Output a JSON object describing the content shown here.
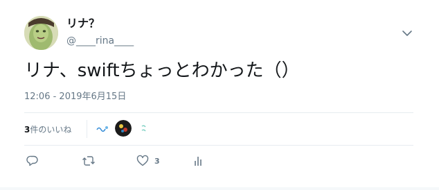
{
  "tweet": {
    "author": {
      "display_name": "リナ？",
      "handle": "@____rina____",
      "avatar_icon": "user-avatar"
    },
    "text": "リナ、swiftちょっとわかった（）",
    "timestamp": "12:06 - 2019年6月15日",
    "likes": {
      "count": "3",
      "label": "件のいいね",
      "likers": [
        "liker-avatar-1",
        "liker-avatar-2",
        "liker-avatar-3"
      ]
    },
    "actions": {
      "reply_icon": "reply-icon",
      "retweet_icon": "retweet-icon",
      "like_icon": "heart-icon",
      "like_count": "3",
      "stats_icon": "analytics-icon"
    }
  },
  "colors": {
    "text_primary": "#14171a",
    "text_secondary": "#657786",
    "divider": "#e6ecf0"
  }
}
